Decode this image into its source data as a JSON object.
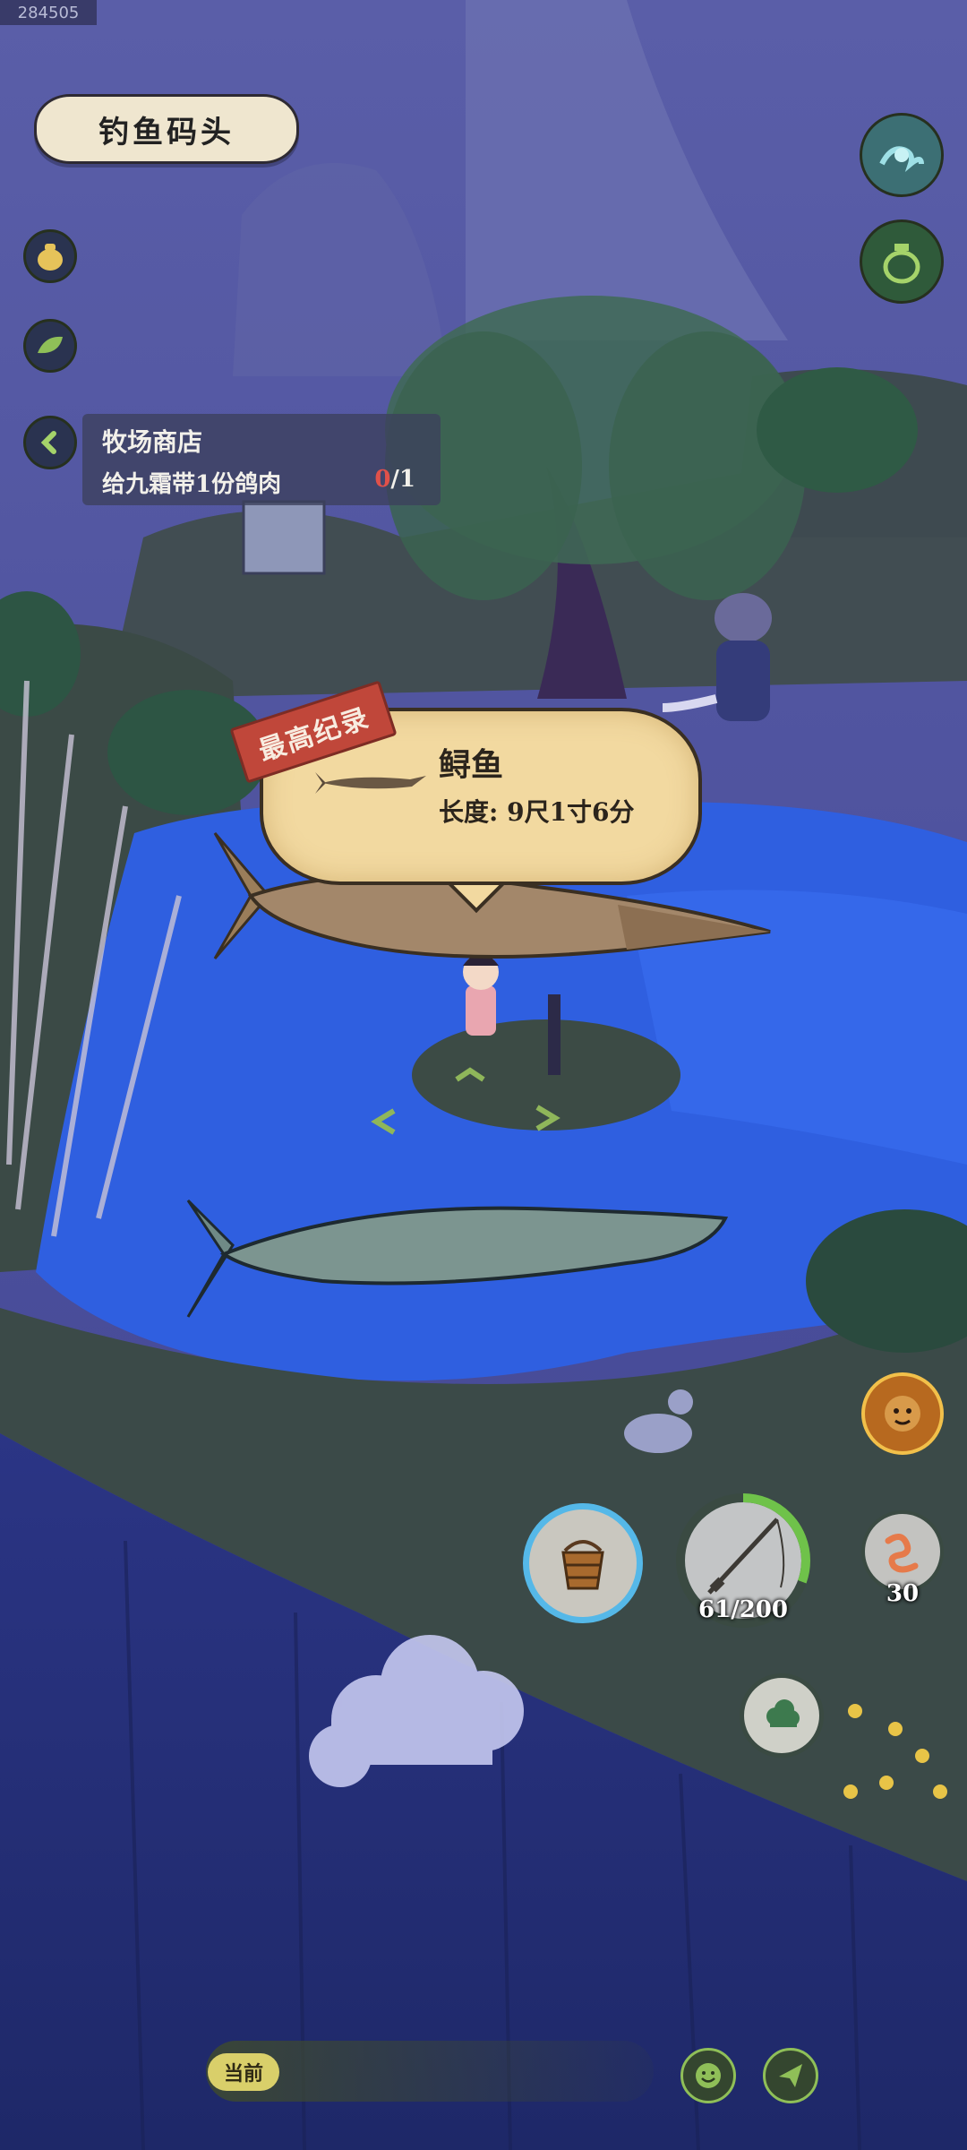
{
  "watermark": "284505",
  "location": {
    "title": "钓鱼码头"
  },
  "quest": {
    "title": "牧场商店",
    "description": "给九霜带1份鸽肉",
    "progress_current": "0",
    "progress_total": "/1"
  },
  "record": {
    "tag": "最高纪录",
    "fish_name": "鲟鱼",
    "length": "长度: 9尺1寸6分"
  },
  "hud": {
    "rod_durability": "61/200",
    "bait_count": "30",
    "rod_progress_fraction": 0.305
  },
  "chat": {
    "channel_label": "当前"
  },
  "colors": {
    "sky": "#4c4f9e",
    "water": "#2f5fe0",
    "grass": "#3d4f43",
    "bubble": "#f2d9a0",
    "record_tag": "#c0473a",
    "quest_progress": "#e0514a"
  },
  "icons": {
    "back": "chevron-left-icon",
    "wave": "wave-icon",
    "bag": "pouch-icon",
    "leaf": "leaf-icon",
    "bucket": "bucket-icon",
    "rod": "fishing-rod-icon",
    "worm": "worm-icon",
    "cloud": "cloud-icon",
    "smile": "smile-icon",
    "send": "send-icon",
    "monkey": "monkey-event-icon"
  }
}
